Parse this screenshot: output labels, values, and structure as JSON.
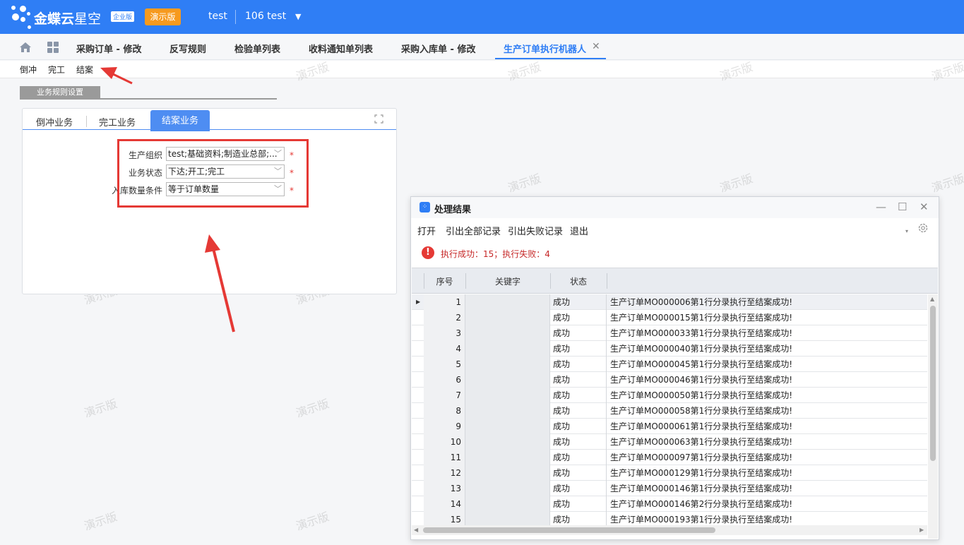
{
  "header": {
    "brand": "金蝶云",
    "brand_light": "星空",
    "edition": "企业版",
    "demo_label": "演示版",
    "user": "test",
    "org": "106  test"
  },
  "tabs": [
    {
      "label": "采购订单 - 修改"
    },
    {
      "label": "反写规则"
    },
    {
      "label": "检验单列表"
    },
    {
      "label": "收料通知单列表"
    },
    {
      "label": "采购入库单 - 修改"
    },
    {
      "label": "生产订单执行机器人"
    }
  ],
  "toolbar": {
    "items": [
      "倒冲",
      "完工",
      "结案"
    ]
  },
  "rules": {
    "section_title": "业务规则设置",
    "tabs": [
      "倒冲业务",
      "完工业务",
      "结案业务"
    ],
    "active_tab": "结案业务",
    "fields": [
      {
        "label": "生产组织",
        "value": "test;基础资料;制造业总部;...",
        "required": "*"
      },
      {
        "label": "业务状态",
        "value": "下达;开工;完工",
        "required": "*"
      },
      {
        "label": "入库数量条件",
        "value": "等于订单数量",
        "required": "*"
      }
    ]
  },
  "watermark": "演示版",
  "dialog": {
    "title": "处理结果",
    "menu": [
      "打开",
      "引出全部记录",
      "引出失败记录",
      "退出"
    ],
    "status": "执行成功：15；执行失败：4",
    "columns": [
      "序号",
      "关键字",
      "状态"
    ],
    "rows": [
      {
        "idx": "1",
        "status": "成功",
        "msg": "生产订单MO000006第1行分录执行至结案成功!"
      },
      {
        "idx": "2",
        "status": "成功",
        "msg": "生产订单MO000015第1行分录执行至结案成功!"
      },
      {
        "idx": "3",
        "status": "成功",
        "msg": "生产订单MO000033第1行分录执行至结案成功!"
      },
      {
        "idx": "4",
        "status": "成功",
        "msg": "生产订单MO000040第1行分录执行至结案成功!"
      },
      {
        "idx": "5",
        "status": "成功",
        "msg": "生产订单MO000045第1行分录执行至结案成功!"
      },
      {
        "idx": "6",
        "status": "成功",
        "msg": "生产订单MO000046第1行分录执行至结案成功!"
      },
      {
        "idx": "7",
        "status": "成功",
        "msg": "生产订单MO000050第1行分录执行至结案成功!"
      },
      {
        "idx": "8",
        "status": "成功",
        "msg": "生产订单MO000058第1行分录执行至结案成功!"
      },
      {
        "idx": "9",
        "status": "成功",
        "msg": "生产订单MO000061第1行分录执行至结案成功!"
      },
      {
        "idx": "10",
        "status": "成功",
        "msg": "生产订单MO000063第1行分录执行至结案成功!"
      },
      {
        "idx": "11",
        "status": "成功",
        "msg": "生产订单MO000097第1行分录执行至结案成功!"
      },
      {
        "idx": "12",
        "status": "成功",
        "msg": "生产订单MO000129第1行分录执行至结案成功!"
      },
      {
        "idx": "13",
        "status": "成功",
        "msg": "生产订单MO000146第1行分录执行至结案成功!"
      },
      {
        "idx": "14",
        "status": "成功",
        "msg": "生产订单MO000146第2行分录执行至结案成功!"
      },
      {
        "idx": "15",
        "status": "成功",
        "msg": "生产订单MO000193第1行分录执行至结案成功!"
      }
    ]
  },
  "colors": {
    "primary": "#2f7ef5",
    "demo_badge": "#f79a1e",
    "highlight_box": "#e53935",
    "status_error": "#c62828"
  }
}
